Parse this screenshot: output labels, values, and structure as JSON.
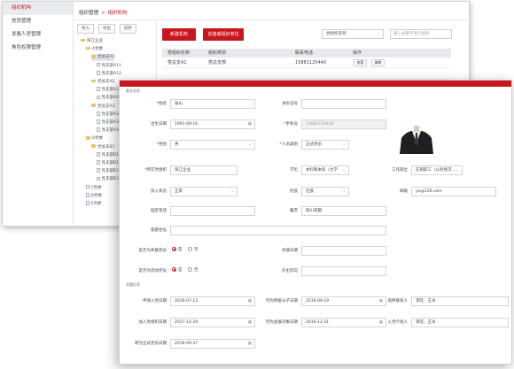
{
  "sidebar": {
    "items": [
      {
        "label": "组织机构",
        "active": true
      },
      {
        "label": "党员管理",
        "active": false
      },
      {
        "label": "发展人员管理",
        "active": false
      },
      {
        "label": "角色权限管理",
        "active": false
      }
    ]
  },
  "breadcrumb": {
    "root": "组织管理",
    "sep": ">",
    "current": "组织机构"
  },
  "tree_buttons": [
    "导入",
    "导出",
    "同步"
  ],
  "tree": [
    {
      "label": "阳江企业",
      "type": "folder"
    },
    {
      "label": "A党委",
      "type": "folder"
    },
    {
      "label": "党总支A1",
      "type": "folder",
      "selected": true
    },
    {
      "label": "党支部A11",
      "type": "doc"
    },
    {
      "label": "党支部A12",
      "type": "doc"
    },
    {
      "label": "党总支A2",
      "type": "folder"
    },
    {
      "label": "党支部A21",
      "type": "doc"
    },
    {
      "label": "党支部A22",
      "type": "doc"
    },
    {
      "label": "党总支A3",
      "type": "folder"
    },
    {
      "label": "党支部A31",
      "type": "doc"
    },
    {
      "label": "党支部A32",
      "type": "doc"
    },
    {
      "label": "党支部A4",
      "type": "doc"
    },
    {
      "label": "B党委",
      "type": "folder"
    },
    {
      "label": "党总支B1",
      "type": "folder"
    },
    {
      "label": "党支部B11",
      "type": "doc"
    },
    {
      "label": "党支部B12",
      "type": "doc"
    },
    {
      "label": "党支部B2",
      "type": "doc"
    },
    {
      "label": "党支部B3",
      "type": "doc"
    },
    {
      "label": "C党委",
      "type": "doc"
    },
    {
      "label": "D党委",
      "type": "doc"
    },
    {
      "label": "E党委",
      "type": "doc"
    }
  ],
  "toolbar": {
    "add_org": "新建机构",
    "create_unit": "创建或组织单位"
  },
  "filter": {
    "select_label": "党组织名称",
    "search_placeholder": "输入关键字进行搜索"
  },
  "table": {
    "headers": [
      "党组织名称",
      "组织类别",
      "联系电话",
      "操作"
    ],
    "rows": [
      {
        "name": "党总支A1",
        "type": "党总支部",
        "phone": "15881125440",
        "ops": [
          "查看",
          "编辑"
        ]
      },
      {
        "name": "",
        "type": "",
        "phone": "",
        "ops": []
      }
    ]
  },
  "form": {
    "section_basic": "基本信息",
    "section_party": "党籍信息",
    "name_label": "姓名",
    "name_value": "张山",
    "idcard_label": "身份证号",
    "idcard_value": "",
    "birth_label": "出生日期",
    "birth_value": "1991-09-16",
    "mobile_label": "手机号",
    "mobile_value": "15881125440",
    "gender_label": "性别",
    "gender_value": "男",
    "category_label": "人员类别",
    "category_value": "正式党员",
    "branch_label": "所在党组织",
    "branch_value": "阳江企业",
    "edu_label": "学历",
    "edu_value": "本科和本科（大学",
    "unit_label": "工作岗位",
    "unit_value": "在岗职工（公有经济...",
    "work_label": "加入状态",
    "work_value": "正常",
    "ethnic_label": "民族",
    "ethnic_value": "壮族",
    "email_label": "邮箱",
    "email_value": "yu@126.com",
    "phone_label": "固定电话",
    "phone_value": "",
    "native_label": "籍贯",
    "native_value": "四川成都",
    "address_label": "家庭住址",
    "address_value": "",
    "missing_label": "是否为失联党员",
    "missing_date_label": "失联日期",
    "mobile_party_label": "是否为流动党员",
    "flow_label": "外出流向",
    "yes": "是",
    "no": "否",
    "apply_label": "申请入党日期",
    "apply_value": "2016-07-13",
    "activist_label": "列为积极分子日期",
    "activist_value": "2016-09-19",
    "contact_label": "培养联系人",
    "contact_value": "李旺、王冰",
    "dev_label": "加入党组织日期",
    "dev_value": "2017-12-29",
    "devobj_label": "列为发展对象日期",
    "devobj_value": "2016-12-21",
    "sponsor_label": "入党介绍人",
    "sponsor_value": "李旺、王冰",
    "formal_label": "转为正式党员日期",
    "formal_value": "2018-09-37"
  },
  "colors": {
    "brand": "#c8161d",
    "sidebar_active_bg": "#e9ebef",
    "table_head_bg": "#e7e9ed"
  }
}
